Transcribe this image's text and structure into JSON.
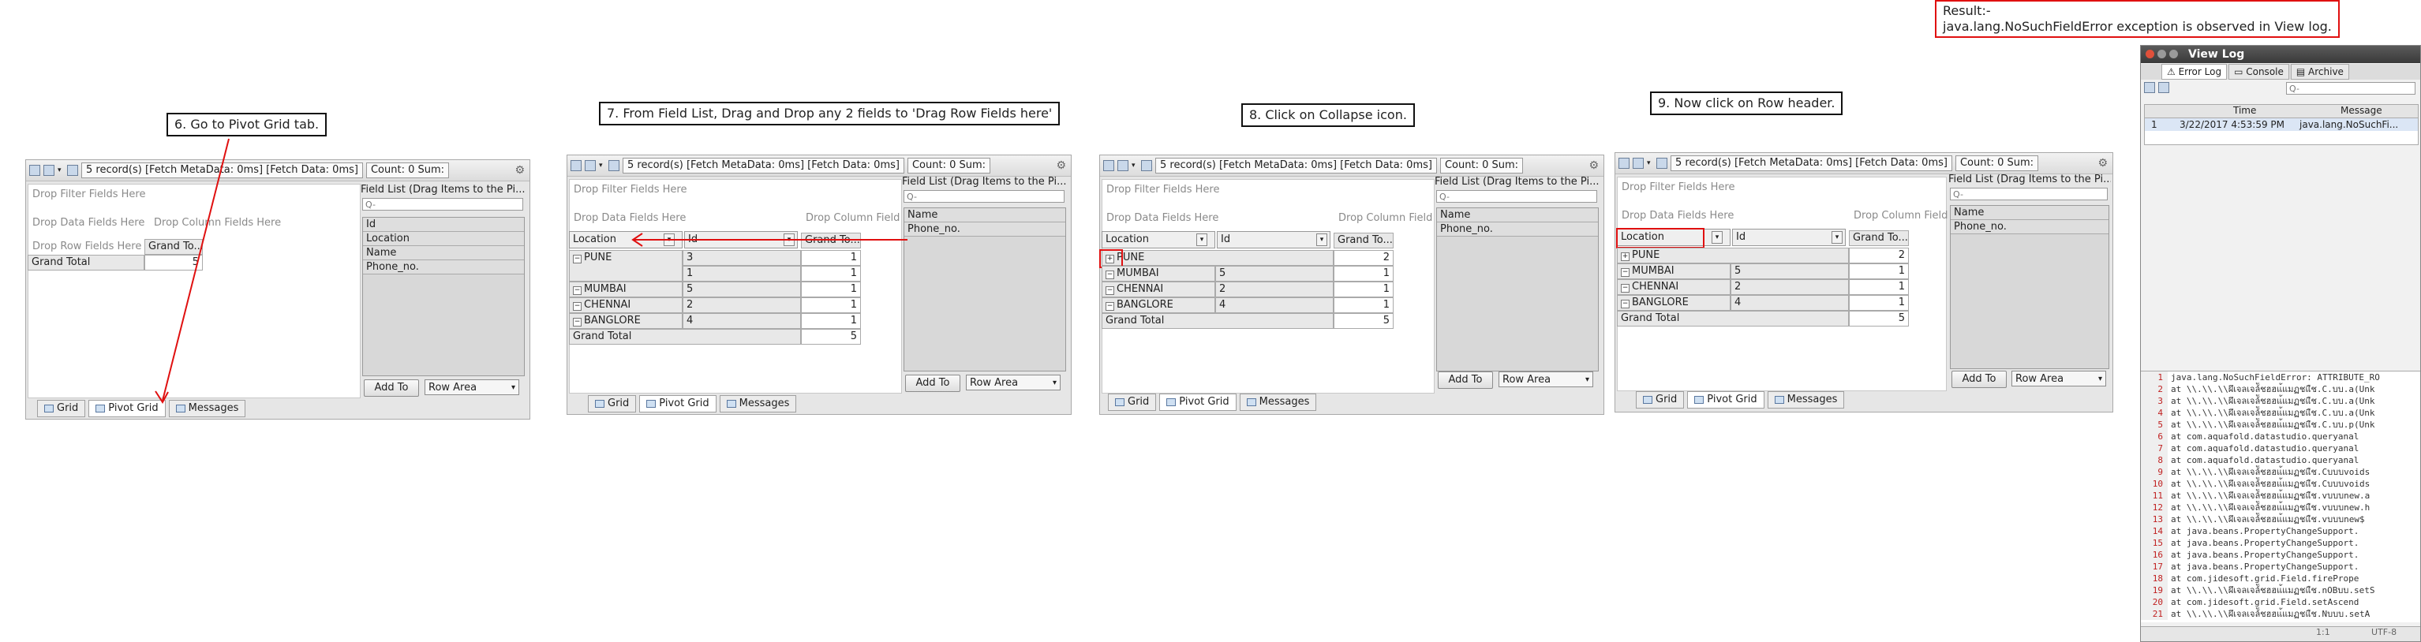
{
  "steps": {
    "s6": "6. Go to Pivot Grid tab.",
    "s7": "7. From Field List, Drag and Drop any 2 fields to 'Drag Row Fields here'",
    "s8": "8. Click on Collapse icon.",
    "s9": "9. Now click on Row header."
  },
  "result": {
    "label": "Result:-",
    "text": "java.lang.NoSuchFieldError exception is observed in View log."
  },
  "toolbar": {
    "status": "5 record(s) [Fetch MetaData: 0ms] [Fetch Data: 0ms]",
    "count": "Count: 0  Sum:"
  },
  "hints": {
    "filter": "Drop Filter Fields Here",
    "data": "Drop Data Fields Here",
    "column": "Drop Column Fields Here",
    "column_short": "Drop Column Field",
    "row": "Drop Row Fields Here"
  },
  "field_list": {
    "title": "Field List (Drag Items to the Pi...",
    "search_placeholder": "Q-",
    "all_fields": [
      "Id",
      "Location",
      "Name",
      "Phone_no."
    ],
    "remaining_fields": [
      "Name",
      "Phone_no."
    ],
    "add_to": "Add To",
    "row_area": "Row Area"
  },
  "tabs": [
    "Grid",
    "Pivot Grid",
    "Messages"
  ],
  "pivot": {
    "grand_total_label": "Grand Total",
    "grand_to": "Grand To...",
    "row_field_1": "Location",
    "row_field_2": "Id",
    "locations": [
      "PUNE",
      "MUMBAI",
      "CHENNAI",
      "BANGLORE"
    ],
    "grand_total_value": "5",
    "expanded_rows": [
      {
        "loc": "PUNE",
        "id": "3",
        "val": "1"
      },
      {
        "loc": "",
        "id": "1",
        "val": "1"
      },
      {
        "loc": "MUMBAI",
        "id": "5",
        "val": "1"
      },
      {
        "loc": "CHENNAI",
        "id": "2",
        "val": "1"
      },
      {
        "loc": "BANGLORE",
        "id": "4",
        "val": "1"
      }
    ],
    "collapsed_rows": [
      {
        "loc": "PUNE",
        "id": "",
        "val": "2"
      },
      {
        "loc": "MUMBAI",
        "id": "5",
        "val": "1"
      },
      {
        "loc": "CHENNAI",
        "id": "2",
        "val": "1"
      },
      {
        "loc": "BANGLORE",
        "id": "4",
        "val": "1"
      }
    ]
  },
  "viewlog": {
    "title": "View Log",
    "tabs": [
      "Error Log",
      "Console",
      "Archive"
    ],
    "search_placeholder": "Q-",
    "headers": [
      "Time",
      "Message"
    ],
    "row": {
      "num": "1",
      "time": "3/22/2017 4:53:59 PM",
      "message": "java.lang.NoSuchFi..."
    },
    "code_lines": [
      "java.lang.NoSuchFieldError: ATTRIBUTE_RO",
      "    at \\\\.\\\\.\\\\ผึเจลเจล์ัชฮฮแ้แมฏชแืช.C.บบ.a(Unk",
      "    at \\\\.\\\\.\\\\ผึเจลเจล์ัชฮฮแ้แมฏชแืช.C.บบ.a(Unk",
      "    at \\\\.\\\\.\\\\ผึเจลเจล์ัชฮฮแ้แมฏชแืช.C.บบ.a(Unk",
      "    at \\\\.\\\\.\\\\ผึเจลเจล์ัชฮฮแ้แมฏชแืช.C.บบ.p(Unk",
      "    at com.aquafold.datastudio.queryanal",
      "    at com.aquafold.datastudio.queryanal",
      "    at com.aquafold.datastudio.queryanal",
      "    at \\\\.\\\\.\\\\ผึเจลเจล์ัชฮฮแ้แมฏชแืช.Cบบบvoids",
      "    at \\\\.\\\\.\\\\ผึเจลเจล์ัชฮฮแ้แมฏชแืช.Cบบบvoids",
      "    at \\\\.\\\\.\\\\ผึเจลเจล์ัชฮฮแ้แมฏชแืช.vบบบnew.a",
      "    at \\\\.\\\\.\\\\ผึเจลเจล์ัชฮฮแ้แมฏชแืช.vบบบnew.h",
      "    at \\\\.\\\\.\\\\ผึเจลเจล์ัชฮฮแ้แมฏชแืช.vบบบnew$",
      "    at java.beans.PropertyChangeSupport.",
      "    at java.beans.PropertyChangeSupport.",
      "    at java.beans.PropertyChangeSupport.",
      "    at java.beans.PropertyChangeSupport.",
      "    at com.jidesoft.grid.Field.firePrope",
      "    at \\\\.\\\\.\\\\ผึเจลเจล์ัชฮฮแ้แมฏชแืช.nOBบบ.setS",
      "    at com.jidesoft.grid.Field.setAscend",
      "    at \\\\.\\\\.\\\\ผึเจลเจล์ัชฮฮแ้แมฏชแืช.Nบบบ.setA"
    ],
    "status_pos": "1:1",
    "status_enc": "UTF-8"
  },
  "colors": {
    "annotation_red": "#e01010"
  }
}
